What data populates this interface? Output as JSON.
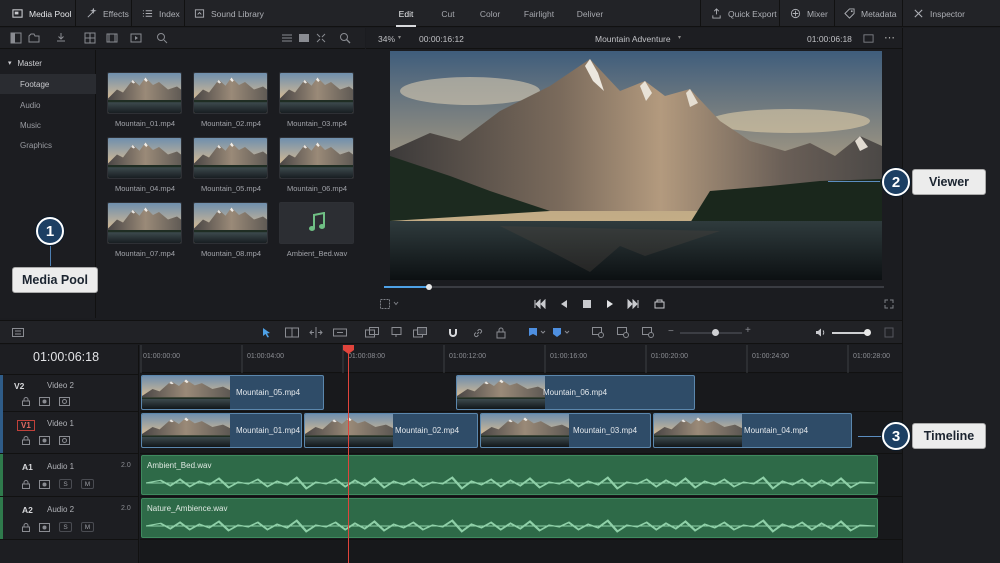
{
  "topbar": {
    "media_pool": "Media Pool",
    "effects": "Effects",
    "index": "Index",
    "sound_library": "Sound Library",
    "quick_export": "Quick Export",
    "mixer": "Mixer",
    "metadata": "Metadata",
    "inspector": "Inspector"
  },
  "pages": [
    "Edit",
    "Cut",
    "Color",
    "Fairlight",
    "Deliver"
  ],
  "bins": {
    "master": "Master",
    "items": [
      "Footage",
      "Audio",
      "Music",
      "Graphics"
    ]
  },
  "clips": [
    {
      "name": "Mountain_01.mp4"
    },
    {
      "name": "Mountain_02.mp4"
    },
    {
      "name": "Mountain_03.mp4"
    },
    {
      "name": "Mountain_04.mp4"
    },
    {
      "name": "Mountain_05.mp4"
    },
    {
      "name": "Mountain_06.mp4"
    },
    {
      "name": "Mountain_07.mp4"
    },
    {
      "name": "Mountain_08.mp4"
    },
    {
      "name": "Ambient_Bed.wav"
    }
  ],
  "viewer": {
    "zoom": "34%",
    "timecode_left": "00:00:16:12",
    "title": "Mountain Adventure",
    "timecode_right": "01:00:06:18",
    "playhead_progress": 0.09
  },
  "timeline": {
    "current_timecode": "01:00:06:18",
    "ruler": [
      "01:00:00:00",
      "01:00:04:00",
      "01:00:08:00",
      "01:00:12:00",
      "01:00:16:00",
      "01:00:20:00",
      "01:00:24:00",
      "01:00:28:00"
    ],
    "tracks": [
      {
        "id": "V2",
        "name": "Video 2"
      },
      {
        "id": "V1",
        "name": "Video 1"
      },
      {
        "id": "A1",
        "name": "Audio 1",
        "level": "2.0"
      },
      {
        "id": "A2",
        "name": "Audio 2",
        "level": "2.0"
      }
    ],
    "v2_clips": [
      "Mountain_05.mp4",
      "Mountain_06.mp4"
    ],
    "v1_clips": [
      "Mountain_01.mp4",
      "Mountain_02.mp4",
      "Mountain_03.mp4",
      "Mountain_04.mp4"
    ],
    "audio_clips": [
      "Ambient_Bed.wav",
      "Nature_Ambience.wav"
    ],
    "solo": "S",
    "mute": "M"
  },
  "callouts": [
    {
      "number": "1",
      "label": "Media Pool"
    },
    {
      "number": "2",
      "label": "Viewer"
    },
    {
      "number": "3",
      "label": "Timeline"
    }
  ],
  "colors": {
    "accent": "#1c3f63",
    "video_clip": "#2f4c68",
    "audio_clip": "#2e6a48",
    "playhead": "#e0443c"
  }
}
